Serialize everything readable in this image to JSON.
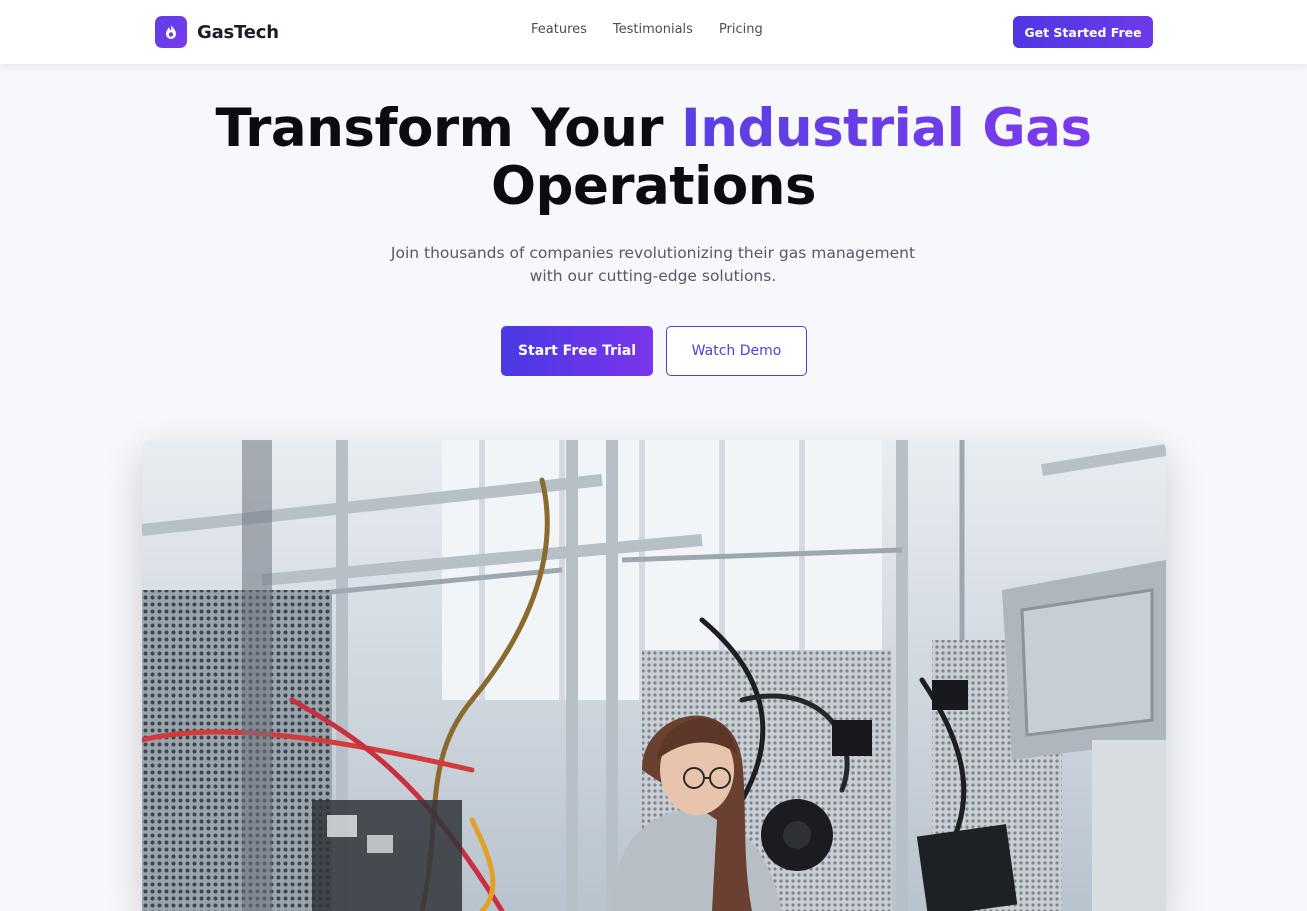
{
  "brand": {
    "name": "GasTech",
    "accent": "#5b3fe8",
    "accent_end": "#7c3aed",
    "icon": "flame-icon"
  },
  "nav": {
    "links": [
      "Features",
      "Testimonials",
      "Pricing"
    ],
    "cta_label": "Get Started Free"
  },
  "hero": {
    "title_line1_plain": "Transform Your ",
    "title_line1_accent": "Industrial Gas",
    "title_line2": "Operations",
    "subtitle_line1": "Join thousands of companies revolutionizing their gas management",
    "subtitle_line2": "with our cutting-edge solutions.",
    "primary_button": "Start Free Trial",
    "secondary_button": "Watch Demo"
  },
  "image": {
    "subject": "engineer-at-electronics-test-rig-photo"
  }
}
